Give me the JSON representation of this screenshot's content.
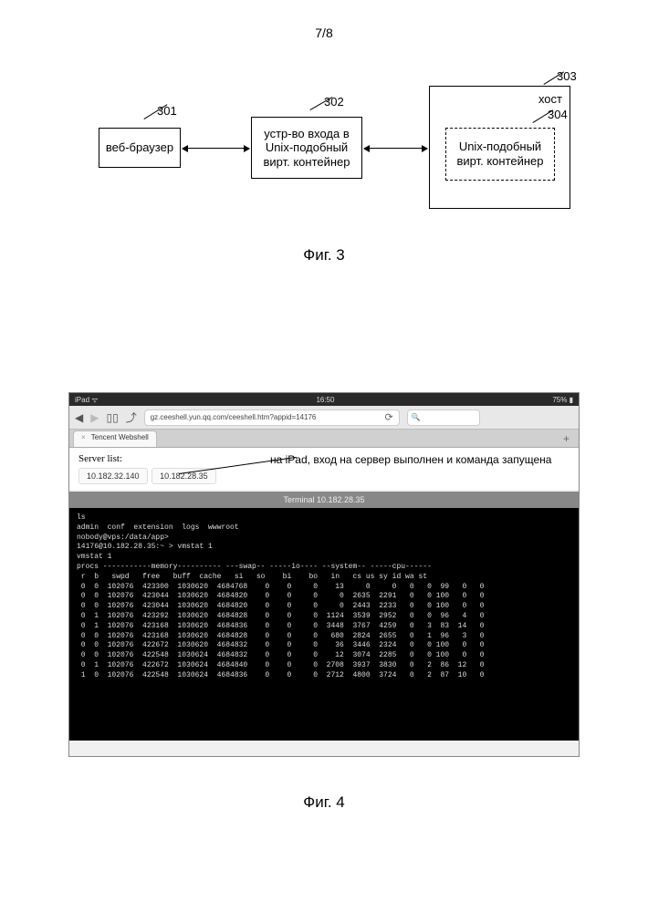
{
  "page_number": "7/8",
  "fig3": {
    "box301": {
      "num": "301",
      "label": "веб-браузер"
    },
    "box302": {
      "num": "302",
      "label": "устр-во входа в Unix-подобный вирт. контейнер"
    },
    "box303": {
      "num": "303",
      "label": "хост"
    },
    "box304": {
      "num": "304",
      "label": "Unix-подобный вирт. контейнер"
    },
    "caption": "Фиг. 3"
  },
  "fig4": {
    "statusbar": {
      "left": "iPad ᯤ",
      "center": "16:50",
      "right": "75% ▮"
    },
    "url": "gz.ceeshell.yun.qq.com/ceeshell.htm?appid=14176",
    "tab_title": "Tencent Webshell",
    "server_list_label": "Server list:",
    "ips": [
      "10.182.32.140",
      "10.182.28.35"
    ],
    "annotation": "на iPad, вход на сервер выполнен и команда запущена",
    "terminal_title": "Terminal 10.182.28.35",
    "term_line1": "ls",
    "term_line2": "admin  conf  extension  logs  wwwroot",
    "term_prompt1": "nobody@vps:/data/app>",
    "term_prompt2": "14176@10.182.28.35:~ > vmstat 1",
    "term_cmd": "vmstat 1",
    "term_header1": "procs -----------memory---------- ---swap-- -----io---- --system-- -----cpu------",
    "term_header2": " r  b   swpd   free   buff  cache   si   so    bi    bo   in   cs us sy id wa st",
    "chart_data": {
      "type": "table",
      "columns": [
        "r",
        "b",
        "swpd",
        "free",
        "buff",
        "cache",
        "si",
        "so",
        "bi",
        "bo",
        "in",
        "cs",
        "us",
        "sy",
        "id",
        "wa",
        "st"
      ],
      "rows": [
        [
          0,
          0,
          102076,
          423300,
          1030620,
          4684768,
          0,
          0,
          0,
          13,
          0,
          0,
          0,
          0,
          99,
          0,
          0
        ],
        [
          0,
          0,
          102076,
          423044,
          1030620,
          4684820,
          0,
          0,
          0,
          0,
          2635,
          2291,
          0,
          0,
          100,
          0,
          0
        ],
        [
          0,
          0,
          102076,
          423044,
          1030620,
          4684820,
          0,
          0,
          0,
          0,
          2443,
          2233,
          0,
          0,
          100,
          0,
          0
        ],
        [
          0,
          1,
          102076,
          423292,
          1030620,
          4684828,
          0,
          0,
          0,
          1124,
          3539,
          2952,
          0,
          0,
          96,
          4,
          0
        ],
        [
          0,
          1,
          102076,
          423168,
          1030620,
          4684836,
          0,
          0,
          0,
          3448,
          3767,
          4259,
          0,
          3,
          83,
          14,
          0
        ],
        [
          0,
          0,
          102076,
          423168,
          1030620,
          4684828,
          0,
          0,
          0,
          680,
          2824,
          2655,
          0,
          1,
          96,
          3,
          0
        ],
        [
          0,
          0,
          102076,
          422672,
          1030620,
          4684832,
          0,
          0,
          0,
          36,
          3446,
          2324,
          0,
          0,
          100,
          0,
          0
        ],
        [
          0,
          0,
          102076,
          422548,
          1030624,
          4684832,
          0,
          0,
          0,
          12,
          3074,
          2285,
          0,
          0,
          100,
          0,
          0
        ],
        [
          0,
          1,
          102076,
          422672,
          1030624,
          4684840,
          0,
          0,
          0,
          2708,
          3937,
          3830,
          0,
          2,
          86,
          12,
          0
        ],
        [
          1,
          0,
          102076,
          422548,
          1030624,
          4684836,
          0,
          0,
          0,
          2712,
          4800,
          3724,
          0,
          2,
          87,
          10,
          0
        ]
      ]
    },
    "caption": "Фиг. 4"
  }
}
